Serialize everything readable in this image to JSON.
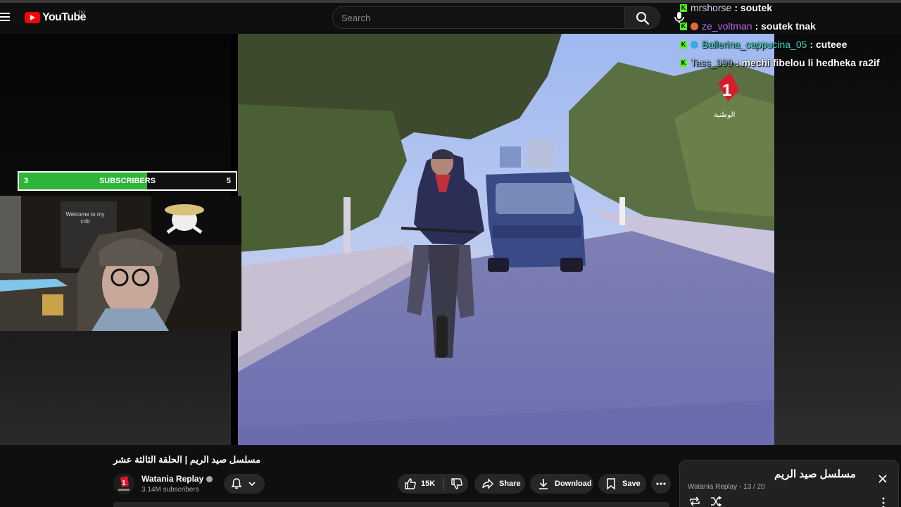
{
  "header": {
    "logo_text": "YouTube",
    "logo_tm": "TN",
    "search_placeholder": "Search"
  },
  "overlay": {
    "subscribers": {
      "start": "3",
      "label": "SUBSCRIBERS",
      "end": "5",
      "progress": 0.59
    },
    "webcam_poster": {
      "line1": "Welcome to  my",
      "line2": "crib"
    },
    "chat": [
      {
        "user": "mrshorse",
        "message": ": soutek",
        "color": "#d9d9f0",
        "badge": "kick"
      },
      {
        "user": "ze_voltman",
        "message": ": soutek tnak",
        "color": "#c56bff",
        "badge": "kick+mini"
      },
      {
        "user": "Ballerina_cappucina_05",
        "message": ": cuteee",
        "color": "#49d5c7",
        "badge": "kick+mini"
      },
      {
        "user": "Tass_999",
        "message": ": mechi fibelou li hedheka ra2if",
        "color": "#a3c2e0",
        "badge": "kick"
      }
    ]
  },
  "video": {
    "title": "مسلسل صيد الريم | الحلقة الثالثة عشر",
    "channel": "Watania Replay",
    "subscribers": "3.14M subscribers",
    "likes": "15K",
    "share_label": "Share",
    "download_label": "Download",
    "save_label": "Save"
  },
  "playlist": {
    "title": "مسلسل صيد الريم",
    "subtitle": "Watania Replay - 13 / 20"
  },
  "colors": {
    "accent": "#ff0000",
    "subbar_fill": "#2fb53a",
    "kick_badge": "#53fc18"
  }
}
